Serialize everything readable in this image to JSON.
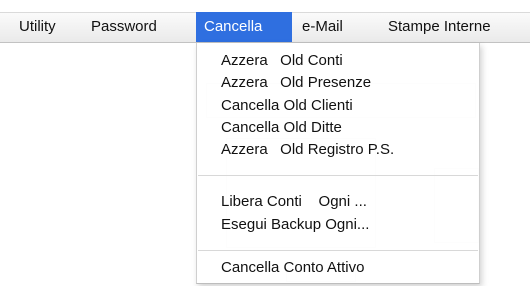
{
  "menubar": {
    "items": [
      {
        "label": "Utility"
      },
      {
        "label": "Password"
      },
      {
        "label": "Cancella",
        "active": true
      },
      {
        "label": "e-Mail"
      },
      {
        "label": "Stampe Interne"
      }
    ]
  },
  "dropdown": {
    "items": [
      {
        "label": "Azzera   Old Conti"
      },
      {
        "label": "Azzera   Old Presenze"
      },
      {
        "label": "Cancella Old Clienti"
      },
      {
        "label": "Cancella Old Ditte"
      },
      {
        "label": "Azzera   Old Registro P.S."
      },
      {
        "label": "Libera Conti    Ogni ..."
      },
      {
        "label": "Esegui Backup Ogni..."
      },
      {
        "label": "Cancella Conto Attivo"
      }
    ]
  },
  "colors": {
    "highlight": "#2f6fe0",
    "highlight_text": "#ffffff",
    "menubar_bg": "#f2f2f2",
    "text": "#111111"
  }
}
